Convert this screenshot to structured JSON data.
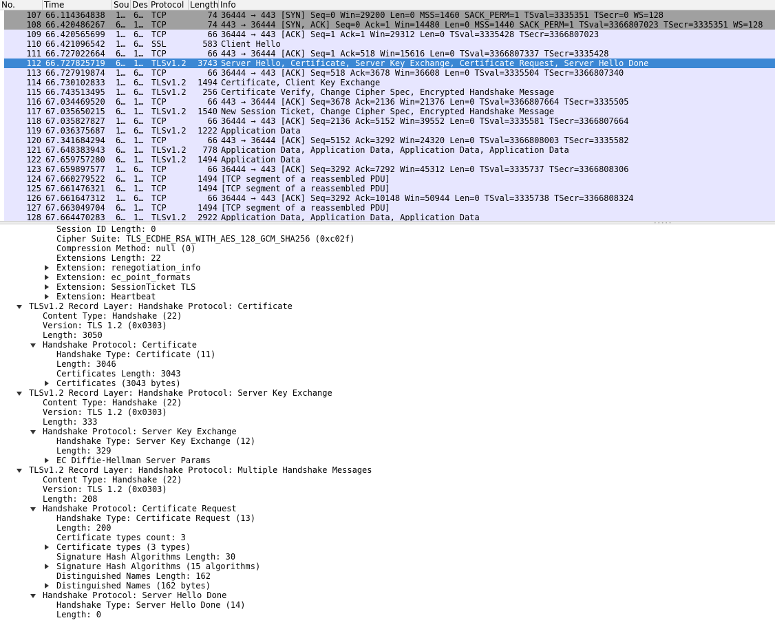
{
  "columns": [
    "No.",
    "Time",
    "Sou",
    "Des",
    "Protocol",
    "Length",
    "Info"
  ],
  "packets": [
    {
      "no": "107",
      "time": "66.114364838",
      "src": "1…",
      "dst": "6…",
      "proto": "TCP",
      "len": "74",
      "info": "36444 → 443 [SYN] Seq=0 Win=29200 Len=0 MSS=1460 SACK_PERM=1 TSval=3335351 TSecr=0 WS=128",
      "style": "syn"
    },
    {
      "no": "108",
      "time": "66.420486267",
      "src": "6…",
      "dst": "1…",
      "proto": "TCP",
      "len": "74",
      "info": "443 → 36444 [SYN, ACK] Seq=0 Ack=1 Win=14480 Len=0 MSS=1440 SACK_PERM=1 TSval=3366807023 TSecr=3335351 WS=128",
      "style": "syn"
    },
    {
      "no": "109",
      "time": "66.420565699",
      "src": "1…",
      "dst": "6…",
      "proto": "TCP",
      "len": "66",
      "info": "36444 → 443 [ACK] Seq=1 Ack=1 Win=29312 Len=0 TSval=3335428 TSecr=3366807023",
      "style": "tcp"
    },
    {
      "no": "110",
      "time": "66.421096542",
      "src": "1…",
      "dst": "6…",
      "proto": "SSL",
      "len": "583",
      "info": "Client Hello",
      "style": "tls"
    },
    {
      "no": "111",
      "time": "66.727022664",
      "src": "6…",
      "dst": "1…",
      "proto": "TCP",
      "len": "66",
      "info": "443 → 36444 [ACK] Seq=1 Ack=518 Win=15616 Len=0 TSval=3366807337 TSecr=3335428",
      "style": "tcp"
    },
    {
      "no": "112",
      "time": "66.727825719",
      "src": "6…",
      "dst": "1…",
      "proto": "TLSv1.2",
      "len": "3743",
      "info": "Server Hello, Certificate, Server Key Exchange, Certificate Request, Server Hello Done",
      "style": "sel"
    },
    {
      "no": "113",
      "time": "66.727919874",
      "src": "1…",
      "dst": "6…",
      "proto": "TCP",
      "len": "66",
      "info": "36444 → 443 [ACK] Seq=518 Ack=3678 Win=36608 Len=0 TSval=3335504 TSecr=3366807340",
      "style": "tcp"
    },
    {
      "no": "114",
      "time": "66.730102833",
      "src": "1…",
      "dst": "6…",
      "proto": "TLSv1.2",
      "len": "1494",
      "info": "Certificate, Client Key Exchange",
      "style": "tls"
    },
    {
      "no": "115",
      "time": "66.743513495",
      "src": "1…",
      "dst": "6…",
      "proto": "TLSv1.2",
      "len": "256",
      "info": "Certificate Verify, Change Cipher Spec, Encrypted Handshake Message",
      "style": "tls"
    },
    {
      "no": "116",
      "time": "67.034469520",
      "src": "6…",
      "dst": "1…",
      "proto": "TCP",
      "len": "66",
      "info": "443 → 36444 [ACK] Seq=3678 Ack=2136 Win=21376 Len=0 TSval=3366807664 TSecr=3335505",
      "style": "tcp"
    },
    {
      "no": "117",
      "time": "67.035650215",
      "src": "6…",
      "dst": "1…",
      "proto": "TLSv1.2",
      "len": "1540",
      "info": "New Session Ticket, Change Cipher Spec, Encrypted Handshake Message",
      "style": "tls"
    },
    {
      "no": "118",
      "time": "67.035827827",
      "src": "1…",
      "dst": "6…",
      "proto": "TCP",
      "len": "66",
      "info": "36444 → 443 [ACK] Seq=2136 Ack=5152 Win=39552 Len=0 TSval=3335581 TSecr=3366807664",
      "style": "tcp"
    },
    {
      "no": "119",
      "time": "67.036375687",
      "src": "1…",
      "dst": "6…",
      "proto": "TLSv1.2",
      "len": "1222",
      "info": "Application Data",
      "style": "tls"
    },
    {
      "no": "120",
      "time": "67.341684294",
      "src": "6…",
      "dst": "1…",
      "proto": "TCP",
      "len": "66",
      "info": "443 → 36444 [ACK] Seq=5152 Ack=3292 Win=24320 Len=0 TSval=3366808003 TSecr=3335582",
      "style": "tcp"
    },
    {
      "no": "121",
      "time": "67.648383943",
      "src": "6…",
      "dst": "1…",
      "proto": "TLSv1.2",
      "len": "778",
      "info": "Application Data, Application Data, Application Data, Application Data",
      "style": "tls"
    },
    {
      "no": "122",
      "time": "67.659757280",
      "src": "6…",
      "dst": "1…",
      "proto": "TLSv1.2",
      "len": "1494",
      "info": "Application Data",
      "style": "tls"
    },
    {
      "no": "123",
      "time": "67.659897577",
      "src": "1…",
      "dst": "6…",
      "proto": "TCP",
      "len": "66",
      "info": "36444 → 443 [ACK] Seq=3292 Ack=7292 Win=45312 Len=0 TSval=3335737 TSecr=3366808306",
      "style": "tcp"
    },
    {
      "no": "124",
      "time": "67.660279522",
      "src": "6…",
      "dst": "1…",
      "proto": "TCP",
      "len": "1494",
      "info": "[TCP segment of a reassembled PDU]",
      "style": "tcp"
    },
    {
      "no": "125",
      "time": "67.661476321",
      "src": "6…",
      "dst": "1…",
      "proto": "TCP",
      "len": "1494",
      "info": "[TCP segment of a reassembled PDU]",
      "style": "tcp"
    },
    {
      "no": "126",
      "time": "67.661647312",
      "src": "1…",
      "dst": "6…",
      "proto": "TCP",
      "len": "66",
      "info": "36444 → 443 [ACK] Seq=3292 Ack=10148 Win=50944 Len=0 TSval=3335738 TSecr=3366808324",
      "style": "tcp"
    },
    {
      "no": "127",
      "time": "67.663049704",
      "src": "6…",
      "dst": "1…",
      "proto": "TCP",
      "len": "1494",
      "info": "[TCP segment of a reassembled PDU]",
      "style": "tcp"
    },
    {
      "no": "128",
      "time": "67.664470283",
      "src": "6…",
      "dst": "1…",
      "proto": "TLSv1.2",
      "len": "2922",
      "info": "Application Data, Application Data, Application Data",
      "style": "tls"
    }
  ],
  "details": [
    {
      "level": 3,
      "text": "Session ID Length: 0",
      "arrow": "none"
    },
    {
      "level": 3,
      "text": "Cipher Suite: TLS_ECDHE_RSA_WITH_AES_128_GCM_SHA256 (0xc02f)",
      "arrow": "none"
    },
    {
      "level": 3,
      "text": "Compression Method: null (0)",
      "arrow": "none"
    },
    {
      "level": 3,
      "text": "Extensions Length: 22",
      "arrow": "none"
    },
    {
      "level": 3,
      "text": "Extension: renegotiation_info",
      "arrow": "collapsed"
    },
    {
      "level": 3,
      "text": "Extension: ec_point_formats",
      "arrow": "collapsed"
    },
    {
      "level": 3,
      "text": "Extension: SessionTicket TLS",
      "arrow": "collapsed"
    },
    {
      "level": 3,
      "text": "Extension: Heartbeat",
      "arrow": "collapsed"
    },
    {
      "level": 1,
      "text": "TLSv1.2 Record Layer: Handshake Protocol: Certificate",
      "arrow": "expanded"
    },
    {
      "level": 2,
      "text": "Content Type: Handshake (22)",
      "arrow": "none"
    },
    {
      "level": 2,
      "text": "Version: TLS 1.2 (0x0303)",
      "arrow": "none"
    },
    {
      "level": 2,
      "text": "Length: 3050",
      "arrow": "none"
    },
    {
      "level": 2,
      "text": "Handshake Protocol: Certificate",
      "arrow": "expanded"
    },
    {
      "level": 3,
      "text": "Handshake Type: Certificate (11)",
      "arrow": "none"
    },
    {
      "level": 3,
      "text": "Length: 3046",
      "arrow": "none"
    },
    {
      "level": 3,
      "text": "Certificates Length: 3043",
      "arrow": "none"
    },
    {
      "level": 3,
      "text": "Certificates (3043 bytes)",
      "arrow": "collapsed"
    },
    {
      "level": 1,
      "text": "TLSv1.2 Record Layer: Handshake Protocol: Server Key Exchange",
      "arrow": "expanded"
    },
    {
      "level": 2,
      "text": "Content Type: Handshake (22)",
      "arrow": "none"
    },
    {
      "level": 2,
      "text": "Version: TLS 1.2 (0x0303)",
      "arrow": "none"
    },
    {
      "level": 2,
      "text": "Length: 333",
      "arrow": "none"
    },
    {
      "level": 2,
      "text": "Handshake Protocol: Server Key Exchange",
      "arrow": "expanded"
    },
    {
      "level": 3,
      "text": "Handshake Type: Server Key Exchange (12)",
      "arrow": "none"
    },
    {
      "level": 3,
      "text": "Length: 329",
      "arrow": "none"
    },
    {
      "level": 3,
      "text": "EC Diffie-Hellman Server Params",
      "arrow": "collapsed"
    },
    {
      "level": 1,
      "text": "TLSv1.2 Record Layer: Handshake Protocol: Multiple Handshake Messages",
      "arrow": "expanded"
    },
    {
      "level": 2,
      "text": "Content Type: Handshake (22)",
      "arrow": "none"
    },
    {
      "level": 2,
      "text": "Version: TLS 1.2 (0x0303)",
      "arrow": "none"
    },
    {
      "level": 2,
      "text": "Length: 208",
      "arrow": "none"
    },
    {
      "level": 2,
      "text": "Handshake Protocol: Certificate Request",
      "arrow": "expanded"
    },
    {
      "level": 3,
      "text": "Handshake Type: Certificate Request (13)",
      "arrow": "none"
    },
    {
      "level": 3,
      "text": "Length: 200",
      "arrow": "none"
    },
    {
      "level": 3,
      "text": "Certificate types count: 3",
      "arrow": "none"
    },
    {
      "level": 3,
      "text": "Certificate types (3 types)",
      "arrow": "collapsed"
    },
    {
      "level": 3,
      "text": "Signature Hash Algorithms Length: 30",
      "arrow": "none"
    },
    {
      "level": 3,
      "text": "Signature Hash Algorithms (15 algorithms)",
      "arrow": "collapsed"
    },
    {
      "level": 3,
      "text": "Distinguished Names Length: 162",
      "arrow": "none"
    },
    {
      "level": 3,
      "text": "Distinguished Names (162 bytes)",
      "arrow": "collapsed"
    },
    {
      "level": 2,
      "text": "Handshake Protocol: Server Hello Done",
      "arrow": "expanded"
    },
    {
      "level": 3,
      "text": "Handshake Type: Server Hello Done (14)",
      "arrow": "none"
    },
    {
      "level": 3,
      "text": "Length: 0",
      "arrow": "none"
    }
  ],
  "colors": {
    "syn_row": "#a0a0a0",
    "tcp_row": "#e7e6ff",
    "selected_row": "#3b87d4",
    "selected_text": "#ffffff"
  },
  "icons": {
    "collapsed": "triangle-right-icon",
    "expanded": "triangle-down-icon"
  }
}
